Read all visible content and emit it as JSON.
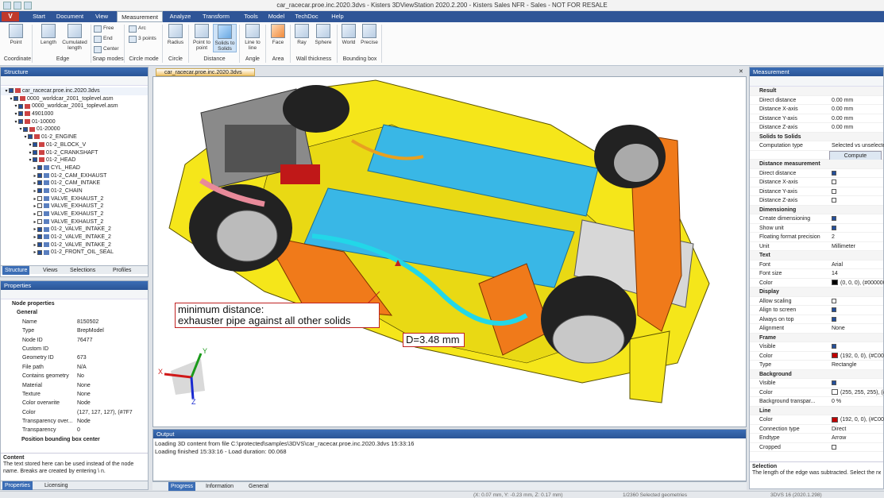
{
  "window": {
    "title": "car_racecar.proe.inc.2020.3dvs - Kisters 3DViewStation 2020.2.200 - Kisters Sales NFR - Sales - NOT FOR RESALE"
  },
  "app_logo": "V",
  "menu_tabs": [
    "Start",
    "Document",
    "View",
    "Measurement",
    "Analyze",
    "Transform",
    "Tools",
    "Model",
    "TechDoc",
    "Help"
  ],
  "ribbon": {
    "buttons": [
      {
        "label": "Point",
        "group": "Coordinate",
        "icon": "point-icon"
      },
      {
        "label": "Length",
        "icon": "length-icon"
      },
      {
        "label": "Cumulated length",
        "icon": "cumulated-length-icon"
      },
      {
        "label": "Radius",
        "icon": "radius-icon"
      },
      {
        "label": "Point to point",
        "icon": "point-to-point-icon"
      },
      {
        "label": "Solids to Solids",
        "icon": "solids-to-solids-icon"
      },
      {
        "label": "Line to line",
        "icon": "line-to-line-icon"
      },
      {
        "label": "Face",
        "icon": "face-icon"
      },
      {
        "label": "Ray",
        "icon": "ray-icon"
      },
      {
        "label": "Sphere",
        "icon": "sphere-icon"
      },
      {
        "label": "World",
        "icon": "world-icon"
      },
      {
        "label": "Precise",
        "icon": "precise-icon"
      }
    ],
    "snap": [
      "Free",
      "End",
      "Center"
    ],
    "circle": [
      "Arc",
      "3 points"
    ],
    "groups": [
      "Coordinate",
      "Edge",
      "Snap modes",
      "Circle mode",
      "Circle",
      "Distance",
      "Angle",
      "Area",
      "Wall thickness",
      "Bounding box"
    ]
  },
  "structure": {
    "title": "Structure",
    "rows": [
      "car_racecar.proe.inc.2020.3dvs",
      "0000_worldcar_2001_toplevel.asm",
      "0000_worldcar_2001_toplevel.asm",
      "4901000",
      "01-10000",
      "01-20000",
      "01-2_ENGINE",
      "01-2_BLOCK_V",
      "01-2_CRANKSHAFT",
      "01-2_HEAD",
      "CYL_HEAD",
      "01-2_CAM_EXHAUST",
      "01-2_CAM_INTAKE",
      "01-2_CHAIN",
      "VALVE_EXHAUST_2",
      "VALVE_EXHAUST_2",
      "VALVE_EXHAUST_2",
      "VALVE_EXHAUST_2",
      "01-2_VALVE_INTAKE_2",
      "01-2_VALVE_INTAKE_2",
      "01-2_VALVE_INTAKE_2",
      "01-2_FRONT_OIL_SEAL"
    ],
    "tabs": [
      "Structure",
      "Views",
      "Selections",
      "Profiles"
    ]
  },
  "properties": {
    "title": "Properties",
    "sections": [
      "Node properties",
      "General"
    ],
    "rows": [
      {
        "k": "Name",
        "v": "8150502"
      },
      {
        "k": "Type",
        "v": "BrepModel"
      },
      {
        "k": "Node ID",
        "v": "76477"
      },
      {
        "k": "Custom ID",
        "v": ""
      },
      {
        "k": "Geometry ID",
        "v": "673"
      },
      {
        "k": "File path",
        "v": "N/A"
      },
      {
        "k": "Contains geometry",
        "v": "No"
      },
      {
        "k": "Material",
        "v": "None"
      },
      {
        "k": "Texture",
        "v": "None"
      },
      {
        "k": "Color overwrite",
        "v": "Node"
      },
      {
        "k": "Color",
        "v": "(127, 127, 127), (#7F7"
      },
      {
        "k": "Transparency over...",
        "v": "Node"
      },
      {
        "k": "Transparency",
        "v": "0"
      }
    ],
    "sub": "Position bounding box center",
    "content_title": "Content",
    "content_text": "The text stored here can be used instead of the node name. Breaks are created by entering \\ n.",
    "tabs": [
      "Properties",
      "Licensing"
    ]
  },
  "document_tab": "car_racecar.proe.inc.2020.3dvs",
  "viewport": {
    "callout1_line1": "minimum distance:",
    "callout1_line2": "exhauster pipe against all other solids",
    "callout2": "D=3.48 mm",
    "axis_x": "X",
    "axis_y": "Y",
    "axis_z": "Z"
  },
  "output": {
    "title": "Output",
    "lines": [
      "Loading 3D content from file C:\\protected\\samples\\3DVS\\car_racecar.proe.inc.2020.3dvs 15:33:16",
      "Loading finished 15:33:16 - Load duration: 00.068"
    ],
    "tabs": [
      "Progress",
      "Information",
      "General"
    ]
  },
  "measurement": {
    "title": "Measurement",
    "rows": [
      {
        "sec": "Result"
      },
      {
        "k": "Direct distance",
        "v": "0.00 mm"
      },
      {
        "k": "Distance X-axis",
        "v": "0.00 mm"
      },
      {
        "k": "Distance Y-axis",
        "v": "0.00 mm"
      },
      {
        "k": "Distance Z-axis",
        "v": "0.00 mm"
      },
      {
        "sec": "Solids to Solids"
      },
      {
        "k": "Computation type",
        "v": "Selected vs unselected"
      },
      {
        "k": "",
        "v": "Compute",
        "btn": true
      },
      {
        "sec": "Distance measurement"
      },
      {
        "k": "Direct distance",
        "cb": true
      },
      {
        "k": "Distance X-axis",
        "cb": false
      },
      {
        "k": "Distance Y-axis",
        "cb": false
      },
      {
        "k": "Distance Z-axis",
        "cb": false
      },
      {
        "sec": "Dimensioning"
      },
      {
        "k": "Create dimensioning",
        "cb": true
      },
      {
        "k": "Show unit",
        "cb": true
      },
      {
        "k": "Floating format precision",
        "v": "2"
      },
      {
        "k": "Unit",
        "v": "Millimeter"
      },
      {
        "sec": "Text"
      },
      {
        "k": "Font",
        "v": "Arial"
      },
      {
        "k": "Font size",
        "v": "14"
      },
      {
        "k": "Color",
        "v": "(0, 0, 0), (#000000",
        "sw": "#000000"
      },
      {
        "sec": "Display"
      },
      {
        "k": "Allow scaling",
        "cb": false
      },
      {
        "k": "Align to screen",
        "cb": true
      },
      {
        "k": "Always on top",
        "cb": true
      },
      {
        "k": "Alignment",
        "v": "None"
      },
      {
        "sec": "Frame"
      },
      {
        "k": "Visible",
        "cb": true
      },
      {
        "k": "Color",
        "v": "(192, 0, 0), (#C000",
        "sw": "#c00000"
      },
      {
        "k": "Type",
        "v": "Rectangle"
      },
      {
        "sec": "Background"
      },
      {
        "k": "Visible",
        "cb": true
      },
      {
        "k": "Color",
        "v": "(255, 255, 255), (#F",
        "sw": "#ffffff"
      },
      {
        "k": "Background transpar...",
        "v": "0 %"
      },
      {
        "sec": "Line"
      },
      {
        "k": "Color",
        "v": "(192, 0, 0), (#C000",
        "sw": "#c00000"
      },
      {
        "k": "Connection type",
        "v": "Direct"
      },
      {
        "k": "Endtype",
        "v": "Arrow"
      },
      {
        "k": "Cropped",
        "cb": false
      }
    ],
    "selection_title": "Selection",
    "selection_text": "The length of the edge was subtracted. Select the next edge to add its length or unselect an edge to subtract its length."
  },
  "status": {
    "coords": "(X: 0.07 mm, Y: -0.23 mm, Z: 0.17 mm)",
    "geoms": "1/2360 Selected geometries",
    "version": "3DVS 16 (2020.1.298)"
  }
}
